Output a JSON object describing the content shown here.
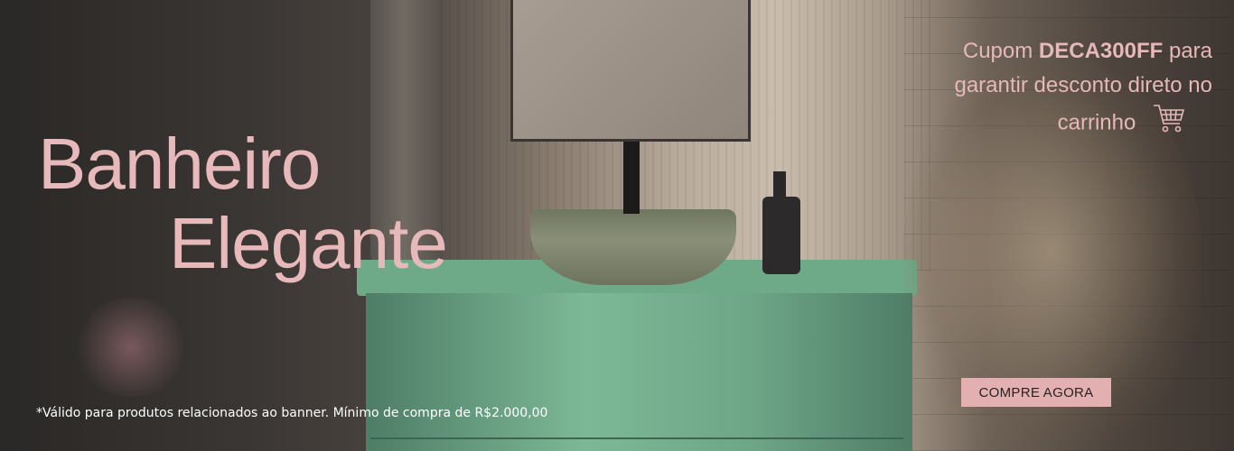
{
  "banner": {
    "title_line1": "Banheiro",
    "title_line2": "Elegante",
    "coupon_prefix": "Cupom ",
    "coupon_code": "DECA300FF",
    "coupon_suffix": " para garantir desconto direto no carrinho",
    "cart_icon": "shopping-cart-icon",
    "disclaimer": "*Válido para produtos relacionados ao banner. Mínimo de compra de R$2.000,00",
    "cta_label": "COMPRE AGORA",
    "colors": {
      "accent": "#e3b0b2",
      "text_pink": "#e8b9bb"
    }
  }
}
